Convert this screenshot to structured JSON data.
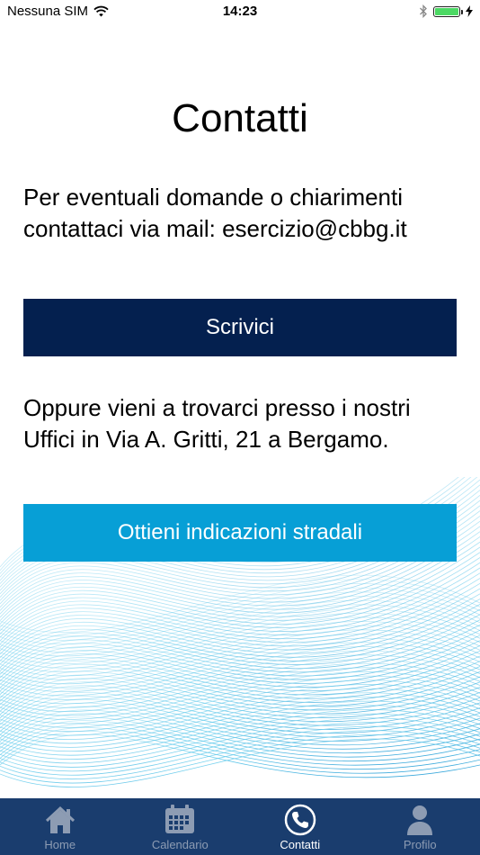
{
  "status_bar": {
    "carrier": "Nessuna SIM",
    "time": "14:23"
  },
  "page": {
    "title": "Contatti",
    "intro_text": "Per eventuali domande o chiarimenti contattaci via mail: esercizio@cbbg.it",
    "write_button": "Scrivici",
    "address_text": "Oppure vieni a trovarci presso i nostri Uffici in Via A. Gritti, 21 a Bergamo.",
    "directions_button": "Ottieni indicazioni stradali"
  },
  "tab_bar": {
    "items": [
      {
        "label": "Home",
        "icon": "home-icon"
      },
      {
        "label": "Calendario",
        "icon": "calendar-icon"
      },
      {
        "label": "Contatti",
        "icon": "phone-icon",
        "active": true
      },
      {
        "label": "Profilo",
        "icon": "person-icon"
      }
    ]
  },
  "colors": {
    "write_button": "#04204f",
    "directions_button": "#079fd6",
    "tab_bar": "#1a3d6e",
    "battery": "#4cd964"
  }
}
